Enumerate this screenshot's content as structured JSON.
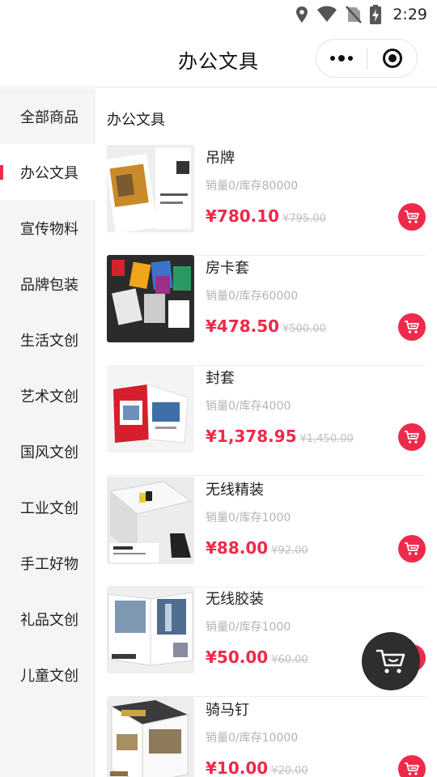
{
  "status_bar": {
    "time": "2:29",
    "icons": [
      "location-icon",
      "wifi-icon",
      "no-sim-icon",
      "battery-charging-icon"
    ]
  },
  "nav": {
    "title": "办公文具",
    "capsule": [
      "more-icon",
      "close-target-icon"
    ]
  },
  "sidebar": {
    "items": [
      {
        "label": "全部商品",
        "active": false
      },
      {
        "label": "办公文具",
        "active": true
      },
      {
        "label": "宣传物料",
        "active": false
      },
      {
        "label": "品牌包装",
        "active": false
      },
      {
        "label": "生活文创",
        "active": false
      },
      {
        "label": "艺术文创",
        "active": false
      },
      {
        "label": "国风文创",
        "active": false
      },
      {
        "label": "工业文创",
        "active": false
      },
      {
        "label": "手工好物",
        "active": false
      },
      {
        "label": "礼品文创",
        "active": false
      },
      {
        "label": "儿童文创",
        "active": false
      }
    ]
  },
  "section": {
    "title": "办公文具"
  },
  "products": [
    {
      "name": "吊牌",
      "stock": "销量0/库存80000",
      "price": "¥780.10",
      "old_price": "¥795.00"
    },
    {
      "name": "房卡套",
      "stock": "销量0/库存60000",
      "price": "¥478.50",
      "old_price": "¥500.00"
    },
    {
      "name": "封套",
      "stock": "销量0/库存4000",
      "price": "¥1,378.95",
      "old_price": "¥1,450.00"
    },
    {
      "name": "无线精装",
      "stock": "销量0/库存1000",
      "price": "¥88.00",
      "old_price": "¥92.00"
    },
    {
      "name": "无线胶装",
      "stock": "销量0/库存1000",
      "price": "¥50.00",
      "old_price": "¥60.00"
    },
    {
      "name": "骑马钉",
      "stock": "销量0/库存10000",
      "price": "¥10.00",
      "old_price": "¥20.00"
    }
  ],
  "colors": {
    "accent": "#ee2a4a",
    "sidebar_bg": "#f5f5f5",
    "float_cart_bg": "#2e2e2e"
  },
  "icons": {
    "add_to_cart": "cart-icon",
    "floating_cart": "shopping-cart-icon"
  }
}
